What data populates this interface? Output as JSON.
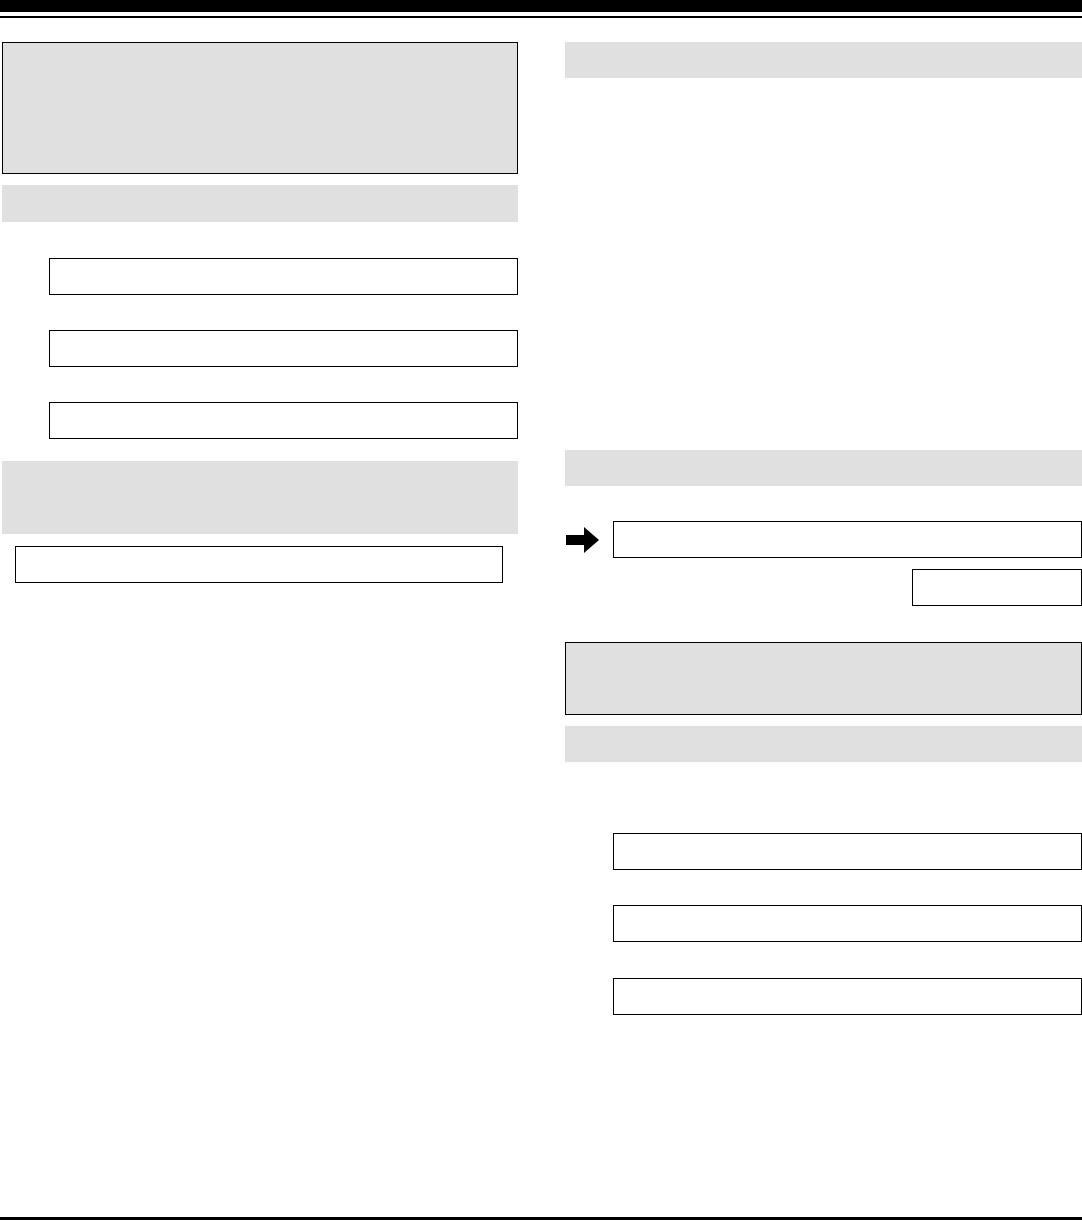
{
  "document": {
    "left_column": {
      "note_box": "",
      "section_header": "",
      "fields": [
        "",
        "",
        ""
      ],
      "section_header_2": "",
      "field_2": ""
    },
    "right_column": {
      "section_header": "",
      "section_header_2": "",
      "arrow_field": "",
      "small_field": "",
      "note_box": "",
      "section_header_3": "",
      "fields": [
        "",
        "",
        ""
      ]
    }
  },
  "icons": {
    "step_pointer": "arrow-right-icon"
  },
  "colors": {
    "shade": "#e0e0e0",
    "rule": "#000000"
  }
}
